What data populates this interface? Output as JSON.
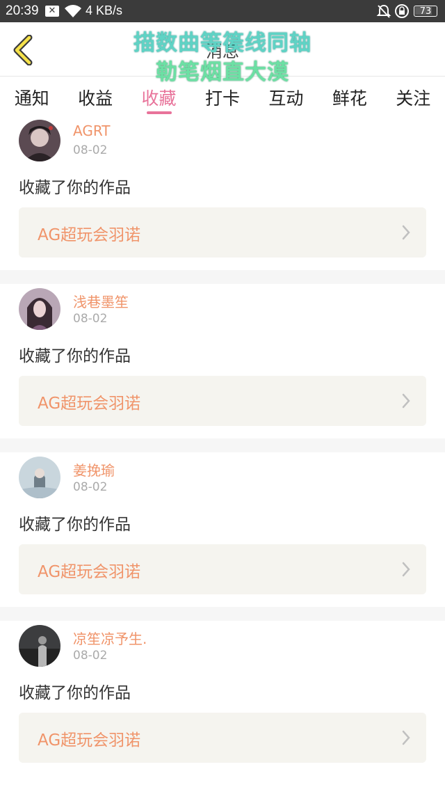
{
  "status_bar": {
    "time": "20:39",
    "notification_icon": "x-box-icon",
    "speed": "4 KB/s",
    "battery": "73"
  },
  "header": {
    "title": "消息",
    "overlay_line1": "描数曲等篌线同轴",
    "overlay_line2": "勒笔烟直大漠"
  },
  "tabs": [
    {
      "label": "通知",
      "active": false
    },
    {
      "label": "收益",
      "active": false
    },
    {
      "label": "收藏",
      "active": true
    },
    {
      "label": "打卡",
      "active": false
    },
    {
      "label": "互动",
      "active": false
    },
    {
      "label": "鲜花",
      "active": false
    },
    {
      "label": "关注",
      "active": false
    }
  ],
  "items": [
    {
      "name": "AGRT",
      "date": "08-02",
      "action": "收藏了你的作品",
      "work": "AG超玩会羽诺"
    },
    {
      "name": "浅巷墨笙",
      "date": "08-02",
      "action": "收藏了你的作品",
      "work": "AG超玩会羽诺"
    },
    {
      "name": "姜挽瑜",
      "date": "08-02",
      "action": "收藏了你的作品",
      "work": "AG超玩会羽诺"
    },
    {
      "name": "凉笙凉予生.",
      "date": "08-02",
      "action": "收藏了你的作品",
      "work": "AG超玩会羽诺"
    }
  ],
  "colors": {
    "accent_pink": "#e8739a",
    "name_orange": "#f0946a",
    "card_bg": "#f5f4ef",
    "status_bar": "#3b3b3b"
  }
}
